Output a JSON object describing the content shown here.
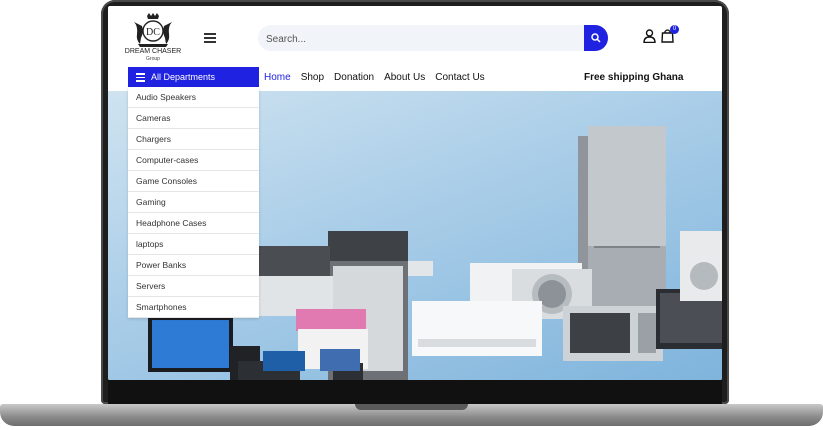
{
  "header": {
    "brand_name": "DREAM CHASER",
    "brand_sub": "Group",
    "search": {
      "placeholder": "Search..."
    },
    "cart_count": "0"
  },
  "departments": {
    "label": "All Departments",
    "items": [
      "Audio Speakers",
      "Cameras",
      "Chargers",
      "Computer-cases",
      "Game Consoles",
      "Gaming",
      "Headphone Cases",
      "laptops",
      "Power Banks",
      "Servers",
      "Smartphones"
    ]
  },
  "nav": {
    "items": [
      "Home",
      "Shop",
      "Donation",
      "About Us",
      "Contact Us"
    ],
    "active": "Home"
  },
  "shipping_text": "Free shipping Ghana",
  "colors": {
    "accent": "#1f22e0",
    "hero_sky": "#a9cde8"
  }
}
